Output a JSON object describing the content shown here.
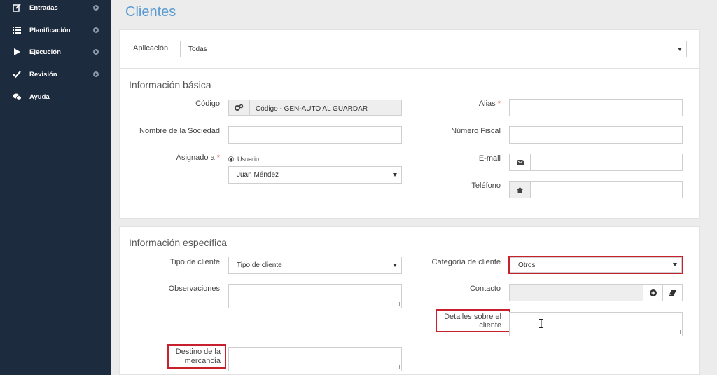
{
  "sidebar": {
    "items": [
      {
        "label": "Entradas",
        "icon": "edit-icon"
      },
      {
        "label": "Planificación",
        "icon": "list-icon"
      },
      {
        "label": "Ejecución",
        "icon": "play-icon"
      },
      {
        "label": "Revisión",
        "icon": "check-icon"
      },
      {
        "label": "Ayuda",
        "icon": "chat-icon"
      }
    ]
  },
  "page": {
    "title": "Clientes"
  },
  "app_filter": {
    "label": "Aplicación",
    "value": "Todas"
  },
  "basic": {
    "title": "Información básica",
    "codigo_label": "Código",
    "codigo_value": "Código - GEN-AUTO AL GUARDAR",
    "alias_label": "Alias",
    "sociedad_label": "Nombre de la Sociedad",
    "fiscal_label": "Número Fiscal",
    "asignado_label": "Asignado a",
    "usuario_label": "Usuario",
    "asignado_value": "Juan Méndez",
    "email_label": "E-mail",
    "telefono_label": "Teléfono",
    "required_mark": "*"
  },
  "specific": {
    "title": "Información específica",
    "tipo_label": "Tipo de cliente",
    "tipo_value": "Tipo de cliente",
    "categoria_label": "Categoría de cliente",
    "categoria_value": "Otros",
    "observaciones_label": "Observaciones",
    "contacto_label": "Contacto",
    "detalles_label_1": "Detalles sobre el",
    "detalles_label_2": "cliente",
    "destino_label_1": "Destino de la",
    "destino_label_2": "mercancía"
  },
  "colors": {
    "sidebar": "#1d2b3e",
    "title": "#5b9bd1",
    "highlight": "#c9202d",
    "required": "#d9534f"
  }
}
